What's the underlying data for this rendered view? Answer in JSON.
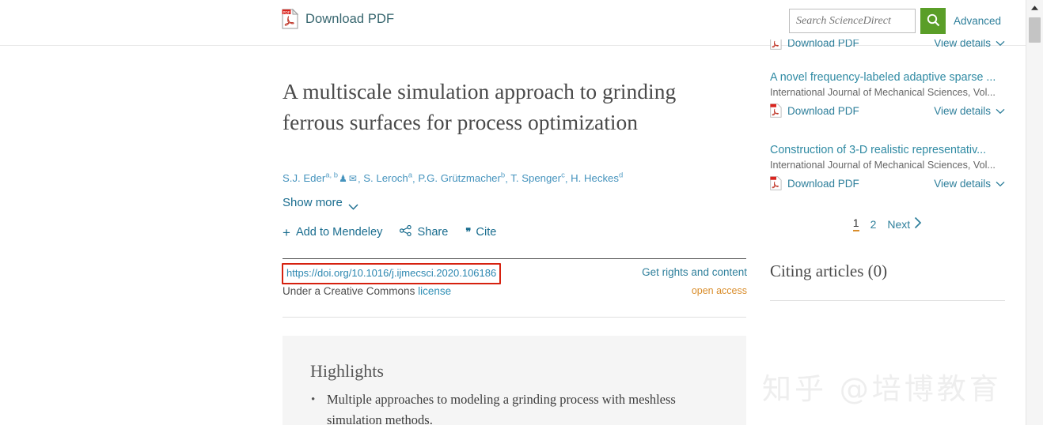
{
  "header": {
    "download_pdf_label": "Download PDF",
    "pdf_icon": "pdf-file-icon"
  },
  "search": {
    "placeholder": "Search ScienceDirect",
    "value": "",
    "button_icon": "search-icon",
    "advanced_label": "Advanced",
    "accent_color": "#5a9e28"
  },
  "article": {
    "title": "A multiscale simulation approach to grinding ferrous surfaces for process optimization",
    "authors_html": "authors-line",
    "authors": [
      {
        "name": "S.J. Eder",
        "affils": "a, b",
        "icons": [
          "person-icon",
          "envelope-icon"
        ]
      },
      {
        "name": "S. Leroch",
        "affils": "a"
      },
      {
        "name": "P.G. Grützmacher",
        "affils": "b"
      },
      {
        "name": "T. Spenger",
        "affils": "c"
      },
      {
        "name": "H. Heckes",
        "affils": "d"
      }
    ],
    "show_more_label": "Show more",
    "actions": [
      {
        "label": "Add to Mendeley",
        "icon": "plus-icon"
      },
      {
        "label": "Share",
        "icon": "share-icon"
      },
      {
        "label": "Cite",
        "icon": "quote-icon"
      }
    ],
    "doi": "https://doi.org/10.1016/j.ijmecsci.2020.106186",
    "doi_highlight_color": "#d6210f",
    "license_prefix": "Under a Creative Commons",
    "license_link": "license",
    "rights_label": "Get rights and content",
    "open_access_label": "open access",
    "open_access_color": "#d98d2b"
  },
  "highlights": {
    "heading": "Highlights",
    "items": [
      "Multiple approaches to modeling a grinding process with meshless simulation methods."
    ]
  },
  "sidebar": {
    "recommended": [
      {
        "title": "",
        "journal": "",
        "download_label": "Download PDF",
        "details_label": "View details",
        "clipped": true
      },
      {
        "title": "A novel frequency-labeled adaptive sparse ...",
        "journal": "International Journal of Mechanical Sciences, Vol...",
        "download_label": "Download PDF",
        "details_label": "View details"
      },
      {
        "title": "Construction of 3-D realistic representativ...",
        "journal": "International Journal of Mechanical Sciences, Vol...",
        "download_label": "Download PDF",
        "details_label": "View details"
      }
    ],
    "pagination": {
      "pages": [
        "1",
        "2"
      ],
      "active": "1",
      "next_label": "Next",
      "active_underline_color": "#d98d2b"
    },
    "citing_articles_heading": "Citing articles (0)"
  },
  "watermark": {
    "text": "知乎 @培博教育"
  },
  "scrollbar": {
    "up_arrow_icon": "triangle-up-icon",
    "thumb": "scrollbar-thumb"
  }
}
